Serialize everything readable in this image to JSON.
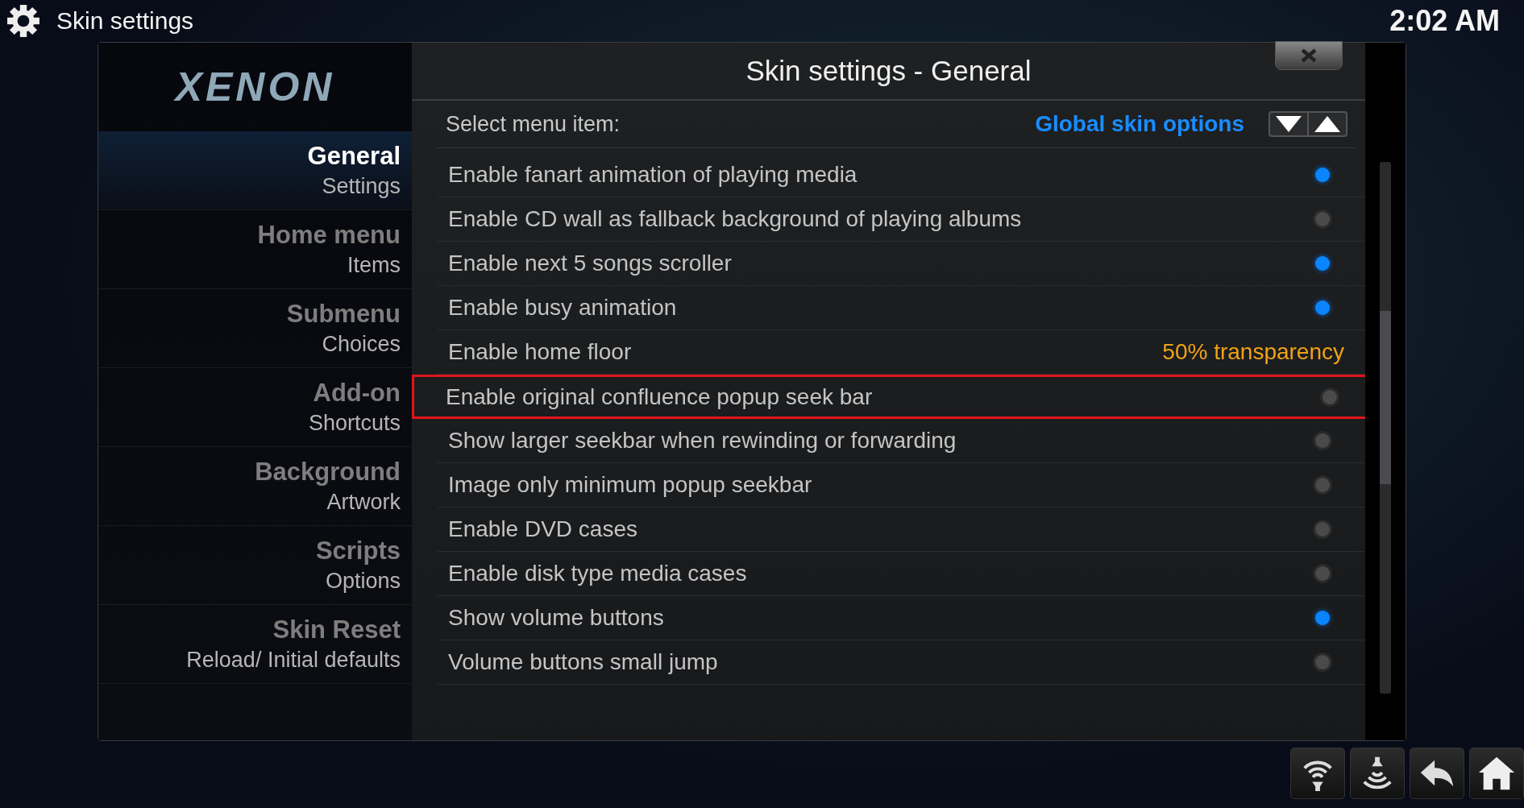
{
  "header": {
    "title": "Skin settings",
    "clock": "2:02 AM"
  },
  "sidebar": {
    "logo": "XENON",
    "items": [
      {
        "title": "General",
        "subtitle": "Settings",
        "selected": true
      },
      {
        "title": "Home menu",
        "subtitle": "Items",
        "selected": false
      },
      {
        "title": "Submenu",
        "subtitle": "Choices",
        "selected": false
      },
      {
        "title": "Add-on",
        "subtitle": "Shortcuts",
        "selected": false
      },
      {
        "title": "Background",
        "subtitle": "Artwork",
        "selected": false
      },
      {
        "title": "Scripts",
        "subtitle": "Options",
        "selected": false
      },
      {
        "title": "Skin Reset",
        "subtitle": "Reload/ Initial defaults",
        "selected": false
      }
    ]
  },
  "dialog": {
    "title": "Skin settings - General"
  },
  "select_row": {
    "label": "Select menu item:",
    "value": "Global skin options"
  },
  "settings": [
    {
      "kind": "toggle",
      "label": "Enable fanart animation of playing media",
      "on": true,
      "focused": false
    },
    {
      "kind": "toggle",
      "label": "Enable CD wall as fallback background of playing albums",
      "on": false,
      "focused": false
    },
    {
      "kind": "toggle",
      "label": "Enable next 5 songs scroller",
      "on": true,
      "focused": false
    },
    {
      "kind": "toggle",
      "label": "Enable busy animation",
      "on": true,
      "focused": false
    },
    {
      "kind": "value",
      "label": "Enable home floor",
      "value": "50% transparency",
      "focused": false
    },
    {
      "kind": "toggle",
      "label": "Enable original confluence popup seek bar",
      "on": false,
      "focused": true
    },
    {
      "kind": "toggle",
      "label": "Show larger seekbar when rewinding or forwarding",
      "on": false,
      "focused": false
    },
    {
      "kind": "toggle",
      "label": "Image only minimum popup seekbar",
      "on": false,
      "focused": false
    },
    {
      "kind": "toggle",
      "label": "Enable DVD cases",
      "on": false,
      "focused": false
    },
    {
      "kind": "toggle",
      "label": "Enable disk type media cases",
      "on": false,
      "focused": false
    },
    {
      "kind": "toggle",
      "label": "Show volume buttons",
      "on": true,
      "focused": false
    },
    {
      "kind": "toggle",
      "label": "Volume buttons small jump",
      "on": false,
      "focused": false
    }
  ]
}
